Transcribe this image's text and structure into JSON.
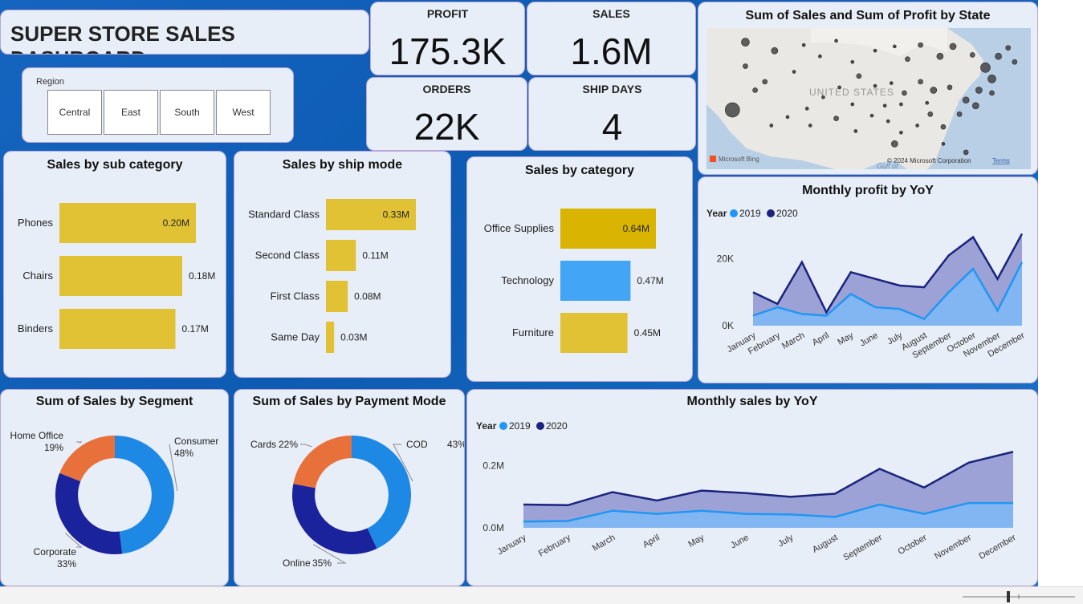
{
  "dashboard": {
    "title": "SUPER STORE SALES DASHBOARD"
  },
  "kpis": {
    "profit": {
      "label": "PROFIT",
      "value": "175.3K"
    },
    "sales": {
      "label": "SALES",
      "value": "1.6M"
    },
    "orders": {
      "label": "ORDERS",
      "value": "22K"
    },
    "ship_days": {
      "label": "SHIP DAYS",
      "value": "4"
    }
  },
  "region_slicer": {
    "label": "Region",
    "options": [
      "Central",
      "East",
      "South",
      "West"
    ]
  },
  "map": {
    "title": "Sum of Sales and Sum of Profit by State",
    "country_label": "UNITED STATES",
    "bing_label": "Microsoft Bing",
    "copyright": "© 2024 Microsoft Corporation",
    "terms": "Terms",
    "gulf_label": "Gulf of",
    "bubbles": [
      [
        0.12,
        0.1,
        5
      ],
      [
        0.21,
        0.16,
        4
      ],
      [
        0.12,
        0.27,
        3
      ],
      [
        0.18,
        0.38,
        3
      ],
      [
        0.08,
        0.58,
        9
      ],
      [
        0.15,
        0.44,
        3
      ],
      [
        0.27,
        0.31,
        2
      ],
      [
        0.3,
        0.12,
        2
      ],
      [
        0.35,
        0.2,
        2
      ],
      [
        0.4,
        0.09,
        2
      ],
      [
        0.45,
        0.24,
        2
      ],
      [
        0.52,
        0.16,
        2
      ],
      [
        0.58,
        0.13,
        2
      ],
      [
        0.62,
        0.22,
        3
      ],
      [
        0.66,
        0.12,
        3
      ],
      [
        0.72,
        0.2,
        4
      ],
      [
        0.76,
        0.13,
        4
      ],
      [
        0.82,
        0.19,
        3
      ],
      [
        0.86,
        0.28,
        6
      ],
      [
        0.9,
        0.2,
        4
      ],
      [
        0.93,
        0.14,
        3
      ],
      [
        0.95,
        0.24,
        3
      ],
      [
        0.88,
        0.36,
        5
      ],
      [
        0.84,
        0.44,
        4
      ],
      [
        0.8,
        0.51,
        4
      ],
      [
        0.75,
        0.42,
        3
      ],
      [
        0.7,
        0.44,
        4
      ],
      [
        0.66,
        0.38,
        3
      ],
      [
        0.61,
        0.46,
        3
      ],
      [
        0.57,
        0.39,
        2
      ],
      [
        0.52,
        0.41,
        2
      ],
      [
        0.47,
        0.34,
        3
      ],
      [
        0.41,
        0.42,
        2
      ],
      [
        0.36,
        0.49,
        2
      ],
      [
        0.31,
        0.57,
        2
      ],
      [
        0.25,
        0.63,
        2
      ],
      [
        0.2,
        0.69,
        2
      ],
      [
        0.32,
        0.69,
        2
      ],
      [
        0.4,
        0.64,
        3
      ],
      [
        0.46,
        0.73,
        2
      ],
      [
        0.51,
        0.62,
        2
      ],
      [
        0.56,
        0.66,
        2
      ],
      [
        0.6,
        0.74,
        2
      ],
      [
        0.65,
        0.69,
        2
      ],
      [
        0.69,
        0.61,
        3
      ],
      [
        0.73,
        0.7,
        3
      ],
      [
        0.78,
        0.61,
        3
      ],
      [
        0.83,
        0.55,
        4
      ],
      [
        0.88,
        0.46,
        3
      ],
      [
        0.6,
        0.54,
        2
      ],
      [
        0.68,
        0.53,
        2
      ],
      [
        0.55,
        0.55,
        2
      ],
      [
        0.45,
        0.54,
        2
      ],
      [
        0.58,
        0.82,
        4
      ],
      [
        0.8,
        0.88,
        3
      ],
      [
        0.73,
        0.82,
        2
      ]
    ]
  },
  "chart_data": [
    {
      "id": "sub_category",
      "type": "bar",
      "title": "Sales by sub category",
      "categories": [
        "Phones",
        "Chairs",
        "Binders"
      ],
      "values": [
        0.2,
        0.18,
        0.17
      ],
      "labels": [
        "0.20M",
        "0.18M",
        "0.17M"
      ],
      "color": "#e1c234"
    },
    {
      "id": "ship_mode",
      "type": "bar",
      "title": "Sales by ship mode",
      "categories": [
        "Standard Class",
        "Second Class",
        "First Class",
        "Same Day"
      ],
      "values": [
        0.33,
        0.11,
        0.08,
        0.03
      ],
      "labels": [
        "0.33M",
        "0.11M",
        "0.08M",
        "0.03M"
      ],
      "color": "#e1c234"
    },
    {
      "id": "category",
      "type": "bar",
      "title": "Sales by category",
      "categories": [
        "Office Supplies",
        "Technology",
        "Furniture"
      ],
      "values": [
        0.64,
        0.47,
        0.45
      ],
      "labels": [
        "0.64M",
        "0.47M",
        "0.45M"
      ],
      "colors": [
        "#d9b400",
        "#42a5f5",
        "#e1c234"
      ]
    },
    {
      "id": "monthly_profit",
      "type": "area",
      "title": "Monthly profit by YoY",
      "legend_title": "Year",
      "categories": [
        "January",
        "February",
        "March",
        "April",
        "May",
        "June",
        "July",
        "August",
        "September",
        "October",
        "November",
        "December"
      ],
      "series": [
        {
          "name": "2019",
          "values": [
            3000,
            5500,
            3500,
            3000,
            9500,
            5500,
            5000,
            2000,
            10000,
            17000,
            4500,
            19000
          ],
          "color": "#2196f3"
        },
        {
          "name": "2020",
          "values": [
            10000,
            6500,
            19000,
            4000,
            16000,
            14000,
            12000,
            11500,
            21000,
            26500,
            14000,
            27500
          ],
          "color": "#1a237e"
        }
      ],
      "yticks": [
        0,
        20000
      ],
      "ytick_labels": [
        "0K",
        "20K"
      ],
      "ylim": [
        0,
        30000
      ]
    },
    {
      "id": "segment",
      "type": "pie",
      "title": "Sum of Sales by Segment",
      "slices": [
        {
          "name": "Consumer",
          "value": 48,
          "label": "48%",
          "color": "#1e88e5"
        },
        {
          "name": "Corporate",
          "value": 33,
          "label": "33%",
          "color": "#1a239b"
        },
        {
          "name": "Home Office",
          "value": 19,
          "label": "19%",
          "color": "#e8703a"
        }
      ]
    },
    {
      "id": "payment_mode",
      "type": "pie",
      "title": "Sum of Sales by Payment Mode",
      "slices": [
        {
          "name": "COD",
          "value": 43,
          "label": "43%",
          "color": "#1e88e5"
        },
        {
          "name": "Online",
          "value": 35,
          "label": "35%",
          "color": "#1a239b"
        },
        {
          "name": "Cards",
          "value": 22,
          "label": "22%",
          "color": "#e8703a"
        }
      ]
    },
    {
      "id": "monthly_sales",
      "type": "area",
      "title": "Monthly sales by YoY",
      "legend_title": "Year",
      "categories": [
        "January",
        "February",
        "March",
        "April",
        "May",
        "June",
        "July",
        "August",
        "September",
        "October",
        "November",
        "December"
      ],
      "series": [
        {
          "name": "2019",
          "values": [
            0.02,
            0.022,
            0.055,
            0.045,
            0.055,
            0.045,
            0.043,
            0.035,
            0.075,
            0.045,
            0.08,
            0.08
          ],
          "color": "#2196f3"
        },
        {
          "name": "2020",
          "values": [
            0.075,
            0.073,
            0.115,
            0.088,
            0.12,
            0.112,
            0.1,
            0.11,
            0.19,
            0.13,
            0.21,
            0.245
          ],
          "color": "#1a237e"
        }
      ],
      "yticks": [
        0,
        0.2
      ],
      "ytick_labels": [
        "0.0M",
        "0.2M"
      ],
      "ylim": [
        0,
        0.3
      ]
    }
  ]
}
